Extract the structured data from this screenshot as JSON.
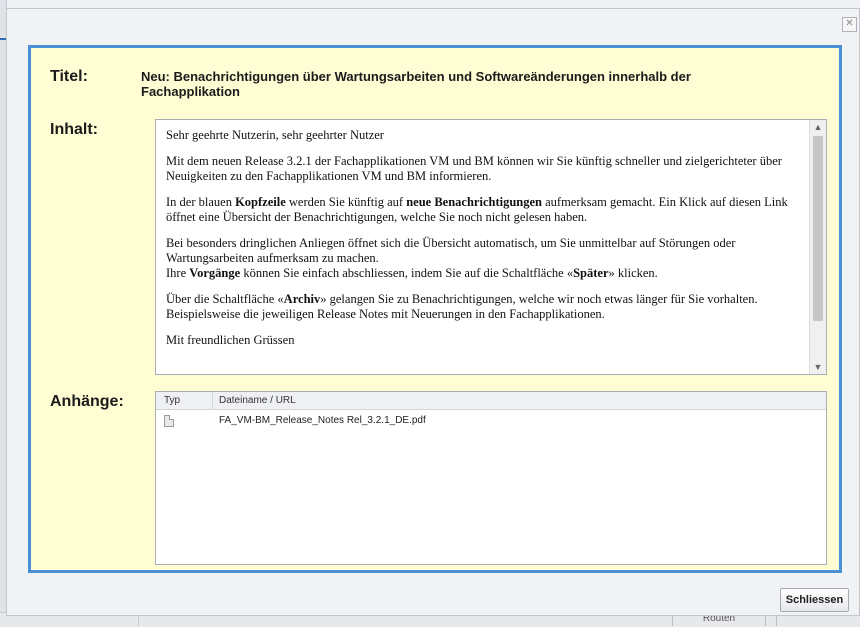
{
  "dialog": {
    "close_glyph": "✕",
    "labels": {
      "title": "Titel:",
      "content": "Inhalt:",
      "attachments": "Anhänge:"
    },
    "title": "Neu: Benachrichtigungen über Wartungsarbeiten und Softwareänderungen innerhalb der Fachapplikation",
    "content": {
      "greeting": "Sehr geehrte Nutzerin, sehr geehrter Nutzer",
      "p1": "Mit dem neuen Release 3.2.1 der Fachapplikationen VM und BM können wir Sie künftig schneller und zielgerichteter über Neuigkeiten zu den Fachapplikationen VM und BM informieren.",
      "p2": {
        "a": "In der blauen ",
        "b_bold": "Kopfzeile",
        "c": " werden Sie künftig auf ",
        "d_bold": "neue Benachrichtigungen",
        "e": " aufmerksam gemacht. Ein Klick auf diesen Link öffnet eine Übersicht der Benachrichtigungen, welche Sie noch nicht gelesen haben."
      },
      "p3": {
        "a": "Bei besonders dringlichen Anliegen öffnet sich die Übersicht automatisch, um Sie unmittelbar auf Störungen oder Wartungsarbeiten aufmerksam zu machen.",
        "b": "Ihre ",
        "c_bold": "Vorgänge",
        "d": " können Sie einfach abschliessen, indem Sie auf die Schaltfläche «",
        "e_bold": "Später",
        "f": "» klicken."
      },
      "p4": {
        "a": "Über die Schaltfläche «",
        "b_bold": "Archiv",
        "c": "» gelangen Sie zu Benachrichtigungen, welche wir noch etwas länger für Sie vorhalten. Beispielsweise die jeweiligen Release Notes mit Neuerungen in den Fachapplikationen."
      },
      "closing": "Mit freundlichen Grüssen"
    },
    "attachments": {
      "columns": {
        "type": "Typ",
        "name": "Dateiname / URL"
      },
      "rows": [
        {
          "icon": "pdf-file-icon",
          "name": "FA_VM-BM_Release_Notes Rel_3.2.1_DE.pdf"
        }
      ]
    },
    "close_button": "Schliessen"
  },
  "background": {
    "bottom_button": "Routen zurücksetzen"
  },
  "colors": {
    "panel_bg": "#fefdd3",
    "panel_border": "#4a90d6"
  }
}
